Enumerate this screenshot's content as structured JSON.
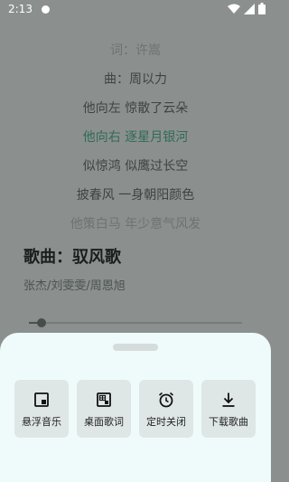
{
  "status_bar": {
    "time": "2:13"
  },
  "lyrics": {
    "lines": [
      "词：许嵩",
      "曲：周以力",
      "他向左 惊散了云朵",
      "他向右 逐星月银河",
      "似惊鸿 似鹰过长空",
      "披春风 一身朝阳颜色",
      "他策白马 年少意气风发"
    ],
    "active_index": 3
  },
  "song": {
    "title": "歌曲：驭风歌",
    "artist": "张杰/刘雯雯/周恩旭",
    "progress": 0.06
  },
  "sheet": {
    "actions": [
      {
        "label": "悬浮音乐",
        "icon": "floating-window-icon"
      },
      {
        "label": "桌面歌词",
        "icon": "desktop-lyrics-icon"
      },
      {
        "label": "定时关闭",
        "icon": "alarm-clock-icon"
      },
      {
        "label": "下载歌曲",
        "icon": "download-icon"
      }
    ]
  },
  "colors": {
    "sheet_background": "#effbfb",
    "active_lyric": "#2f6a58"
  }
}
